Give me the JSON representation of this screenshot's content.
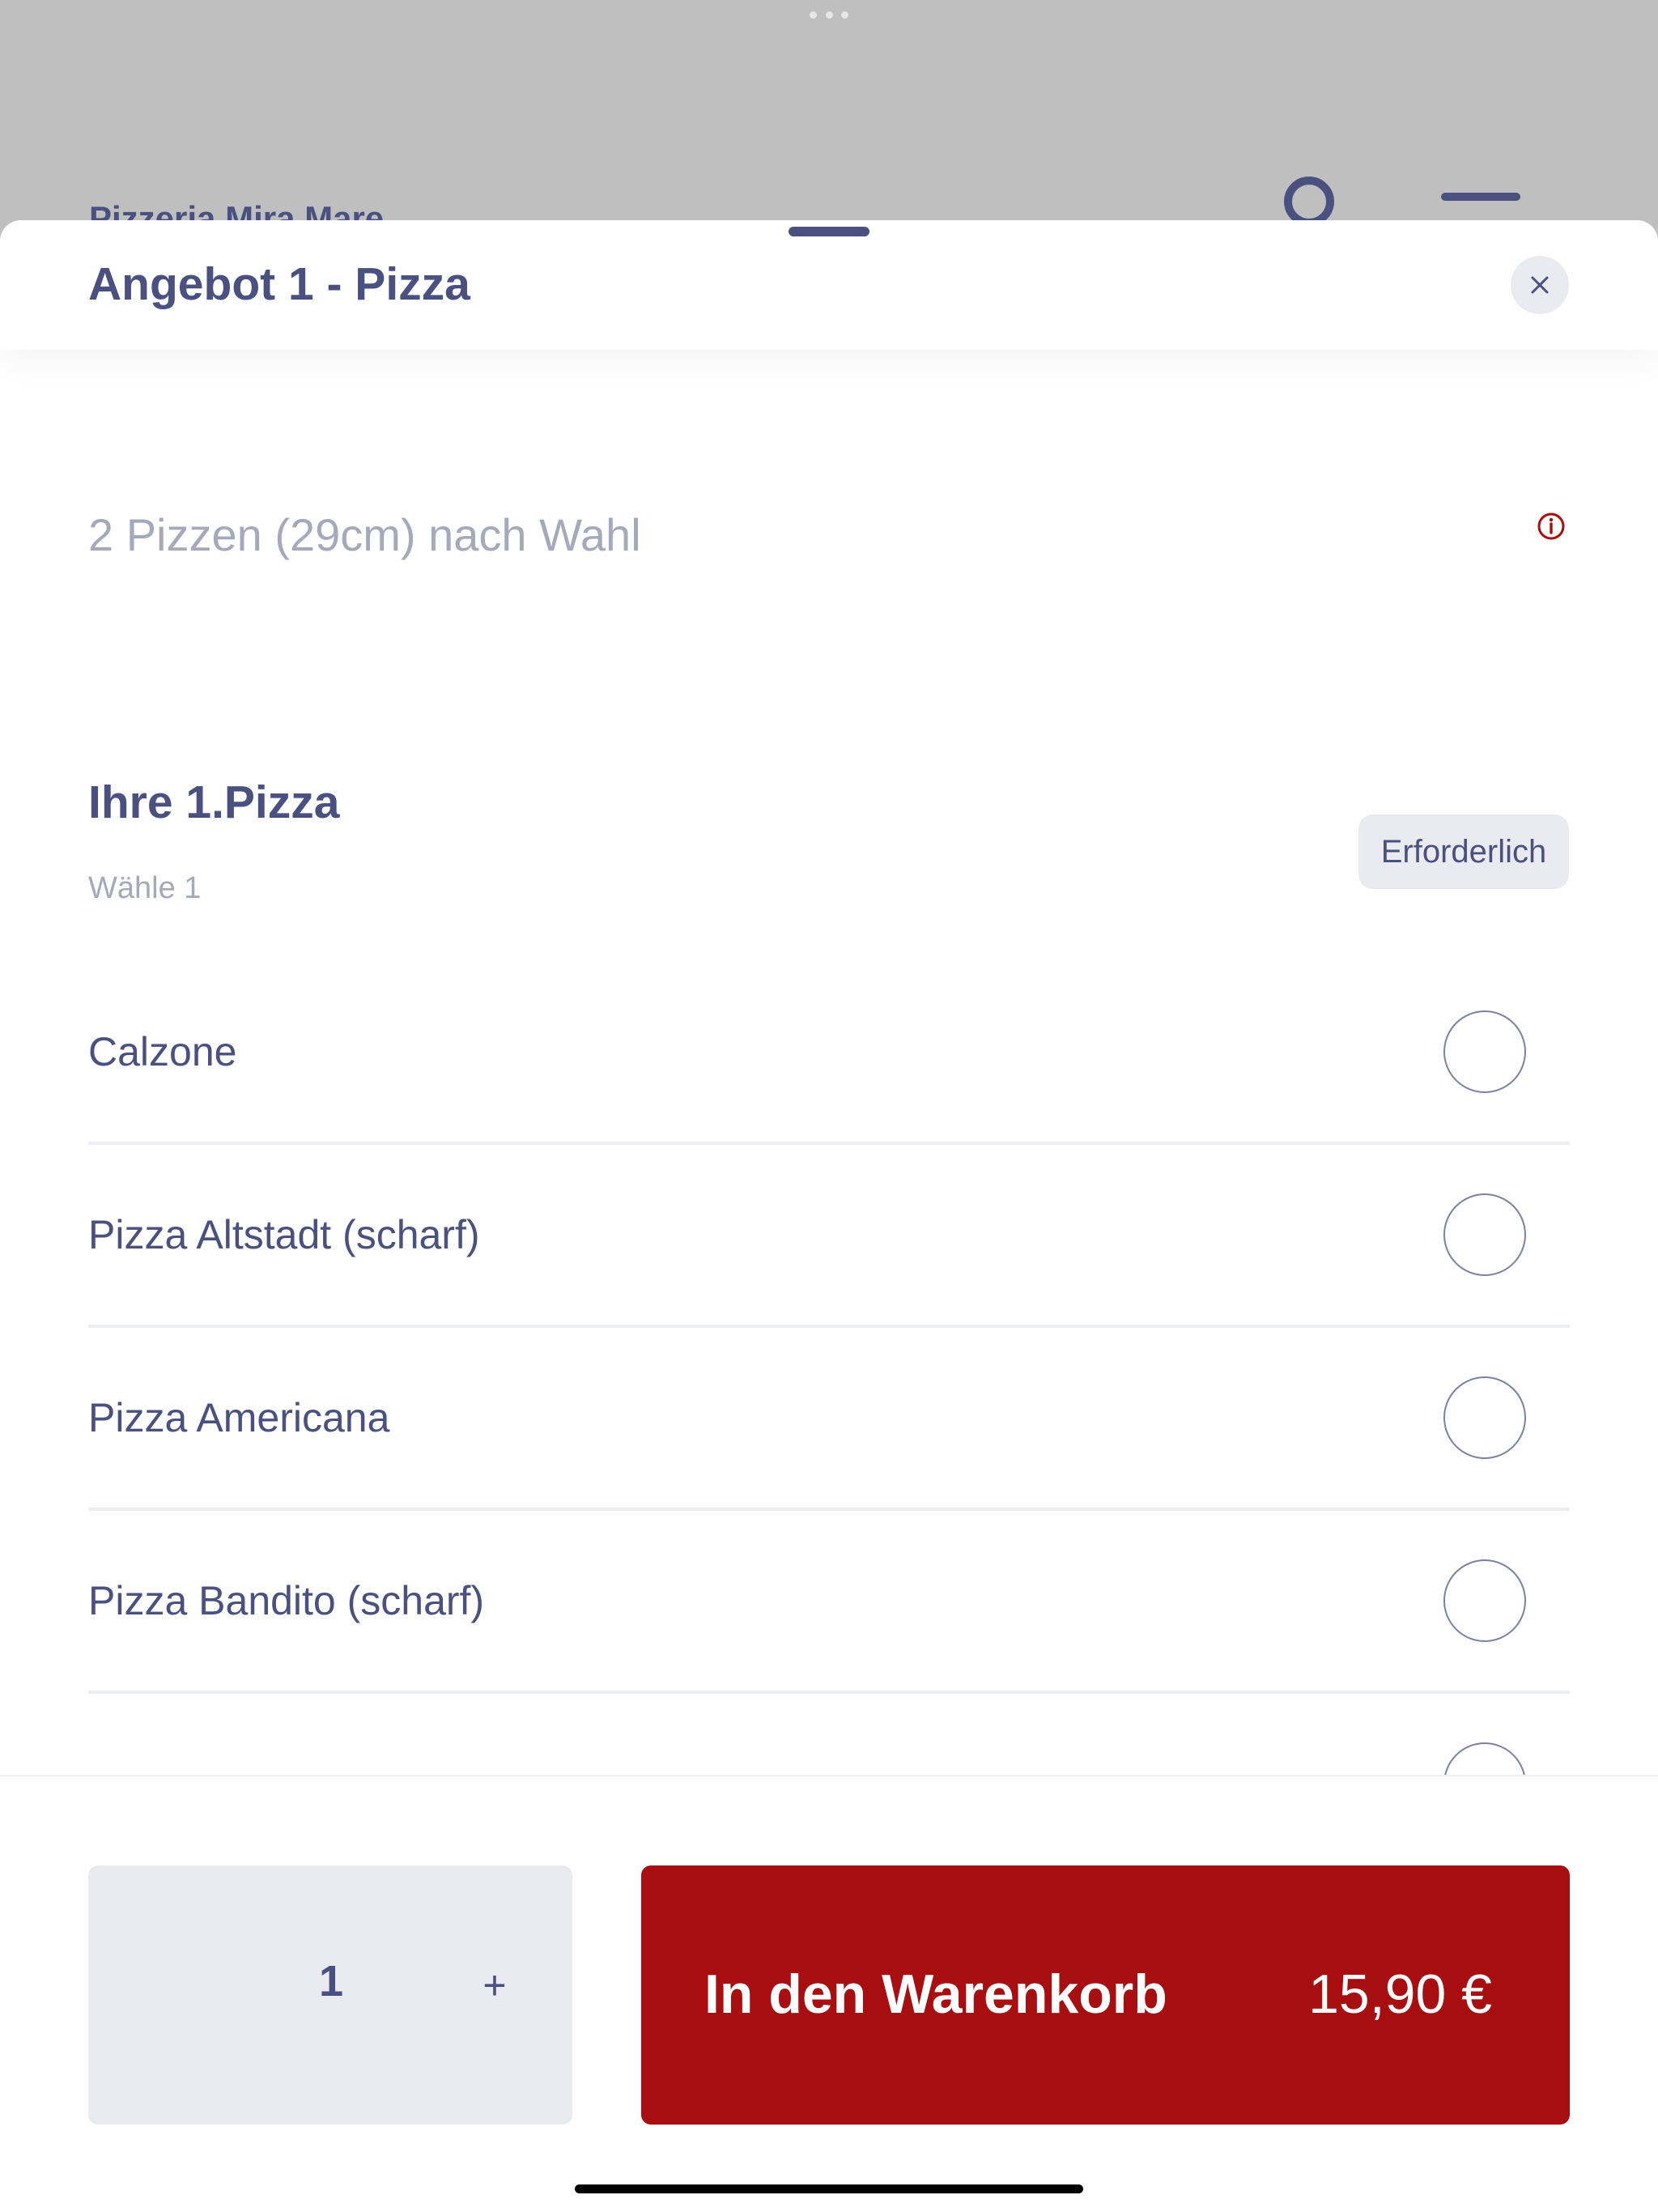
{
  "background": {
    "restaurant_name": "Pizzeria Mira Mare",
    "search_icon": "search-icon",
    "menu_icon": "hamburger-menu-icon"
  },
  "sheet": {
    "title": "Angebot 1 - Pizza",
    "close_icon": "close-icon",
    "description": "2 Pizzen (29cm) nach Wahl",
    "info_icon": "info-icon"
  },
  "group": {
    "title": "Ihre 1.Pizza",
    "subtitle": "Wähle 1",
    "badge": "Erforderlich",
    "options": [
      {
        "label": "Calzone",
        "selected": false
      },
      {
        "label": "Pizza Altstadt (scharf)",
        "selected": false
      },
      {
        "label": "Pizza Americana",
        "selected": false
      },
      {
        "label": "Pizza Bandito (scharf)",
        "selected": false
      }
    ]
  },
  "footer": {
    "quantity": "1",
    "plus_label": "+",
    "cart_label": "In den Warenkorb",
    "price": "15,90 €"
  },
  "colors": {
    "primary_text": "#4a5080",
    "muted_text": "#a7a9ba",
    "accent_red": "#a80d10",
    "chip_bg": "#eaebf0"
  }
}
